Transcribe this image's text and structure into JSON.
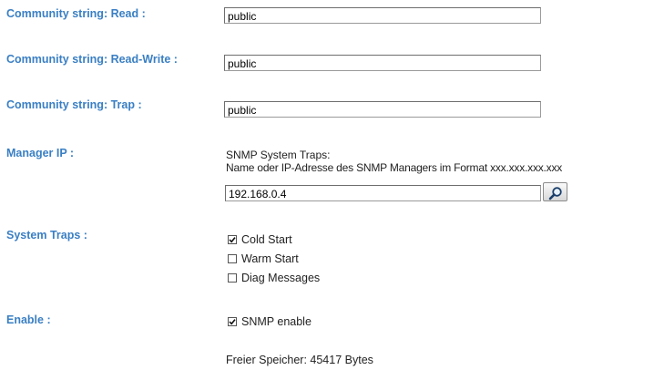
{
  "fields": {
    "read": {
      "label": "Community string: Read :",
      "value": "public"
    },
    "read_write": {
      "label": "Community string: Read-Write :",
      "value": "public"
    },
    "trap": {
      "label": "Community string: Trap :",
      "value": "public"
    }
  },
  "manager_ip": {
    "label": "Manager IP :",
    "info_line1": "SNMP System Traps:",
    "info_line2": "Name oder IP-Adresse des SNMP Managers im Format xxx.xxx.xxx.xxx",
    "value": "192.168.0.4",
    "search_icon": "magnifier-icon"
  },
  "system_traps": {
    "label": "System Traps :",
    "items": [
      {
        "label": "Cold Start",
        "checked": true
      },
      {
        "label": "Warm Start",
        "checked": false
      },
      {
        "label": "Diag Messages",
        "checked": false
      }
    ]
  },
  "enable": {
    "label": "Enable :",
    "snmp_label": "SNMP enable",
    "snmp_checked": true
  },
  "free_memory": "Freier Speicher: 45417 Bytes",
  "colors": {
    "label": "#3a7fc4",
    "text": "#222222",
    "border": "#9a9a9a"
  }
}
